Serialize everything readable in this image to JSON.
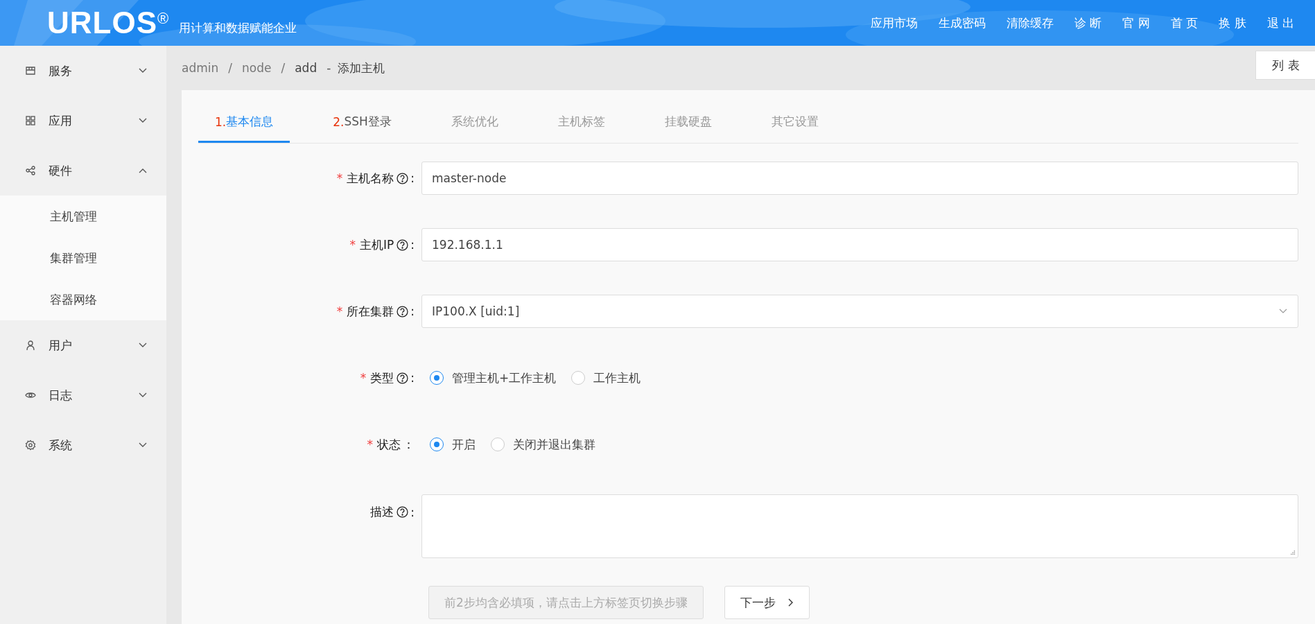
{
  "header": {
    "logo": "URLOS$^{®}$",
    "tagline": "用计算和数据赋能企业",
    "nav": [
      "应用市场",
      "生成密码",
      "清除缓存",
      "诊 断",
      "官 网",
      "首 页",
      "换 肤",
      "退 出"
    ]
  },
  "sidebar": {
    "items": [
      {
        "label": "服务",
        "expanded": false
      },
      {
        "label": "应用",
        "expanded": false
      },
      {
        "label": "硬件",
        "expanded": true,
        "children": [
          {
            "label": "主机管理"
          },
          {
            "label": "集群管理"
          },
          {
            "label": "容器网络"
          }
        ]
      },
      {
        "label": "用户",
        "expanded": false
      },
      {
        "label": "日志",
        "expanded": false
      },
      {
        "label": "系统",
        "expanded": false
      }
    ]
  },
  "breadcrumb": [
    "admin",
    "node",
    "add"
  ],
  "breadcrumb_separator": "/",
  "page_title": "添加主机",
  "title_separator": "-",
  "list_button": "列 表",
  "tabs": [
    {
      "step": "1.",
      "label": "基本信息",
      "selected": true
    },
    {
      "step": "2.",
      "label": "SSH登录",
      "selected": false
    },
    {
      "label": "系统优化",
      "selected": false
    },
    {
      "label": "主机标签",
      "selected": false
    },
    {
      "label": "挂载硬盘",
      "selected": false
    },
    {
      "label": "其它设置",
      "selected": false
    }
  ],
  "form": [
    {
      "kind": "input",
      "required_mark": "*",
      "label": "主机名称",
      "help": true,
      "colon": ":",
      "value": "master-node"
    },
    {
      "kind": "input",
      "required_mark": "*",
      "label": "主机IP",
      "help": true,
      "colon": ":",
      "value": "192.168.1.1"
    },
    {
      "kind": "select",
      "required_mark": "*",
      "label": "所在集群",
      "help": true,
      "colon": ":",
      "value": "IP100.X [uid:1]"
    },
    {
      "kind": "radio",
      "required_mark": "*",
      "label": "类型",
      "help": true,
      "colon": ":",
      "options": [
        {
          "label": "管理主机+工作主机",
          "selected": true
        },
        {
          "label": "工作主机",
          "selected": false
        }
      ]
    },
    {
      "kind": "radio",
      "required_mark": "*",
      "label": "状态",
      "help": false,
      "colon": "：",
      "options": [
        {
          "label": "开启",
          "selected": true
        },
        {
          "label": "关闭并退出集群",
          "selected": false
        }
      ]
    },
    {
      "kind": "textarea",
      "label": "描述",
      "help": true,
      "colon": ":"
    }
  ],
  "buttons": [
    {
      "label": "前2步均含必填项，请点击上方标签页切换步骤",
      "disabled": true,
      "arrow": false
    },
    {
      "label": "下一步",
      "disabled": false,
      "arrow": true
    }
  ]
}
